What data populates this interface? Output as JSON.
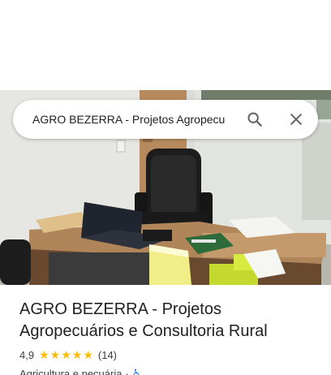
{
  "search": {
    "query": "AGRO BEZERRA - Projetos Agropecu"
  },
  "icons": {
    "search": "search-icon",
    "close": "close-icon",
    "accessibility": "wheelchair-icon"
  },
  "colors": {
    "star": "#fbbc04",
    "accessibility": "#1a73e8"
  },
  "place": {
    "name": "AGRO BEZERRA - Projetos Agropecuários e Consultoria Rural",
    "rating": "4,9",
    "stars": 5,
    "review_count": "(14)",
    "category": "Agricultura e pecuária",
    "separator": "·"
  }
}
